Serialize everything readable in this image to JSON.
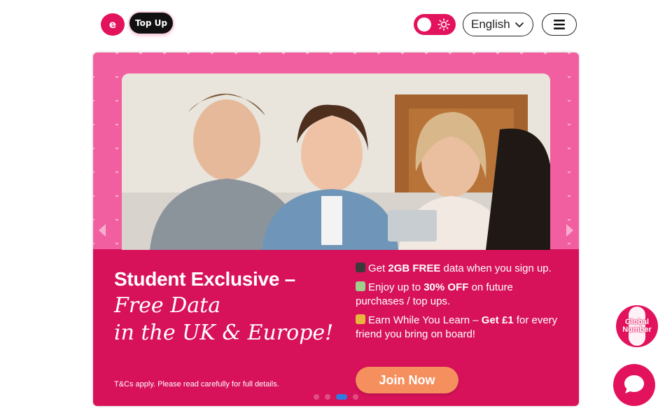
{
  "header": {
    "logo_label": "e",
    "topup_label": "Top Up",
    "language": "English"
  },
  "banner": {
    "headline_1": "Student Exclusive –",
    "headline_2": "Free Data",
    "headline_3": "in the UK & Europe!",
    "tnc": "T&Cs apply. Please read carefully for full details.",
    "bullet_1_pre": "Get ",
    "bullet_1_bold": "2GB FREE",
    "bullet_1_post": " data when you sign up.",
    "bullet_2_pre": "Enjoy up to ",
    "bullet_2_bold": "30% OFF",
    "bullet_2_post": " on future purchases / top ups.",
    "bullet_3_pre": "Earn While You Learn – ",
    "bullet_3_bold": "Get £1",
    "bullet_3_post": " for every friend you bring on board!",
    "cta": "Join Now",
    "slides": 4,
    "active_slide": 3
  },
  "floating": {
    "global_line1": "Global",
    "global_line2": "Number"
  },
  "colors": {
    "brand": "#e3125c",
    "banner_pink": "#f25fa0",
    "banner_magenta": "#d7125a",
    "cta": "#f5905e",
    "dot_active": "#2f7de1"
  },
  "icons": {
    "theme_toggle": "sun-icon",
    "language": "chevron-down-icon",
    "menu": "hamburger-icon",
    "chat": "chat-bubble-icon"
  }
}
